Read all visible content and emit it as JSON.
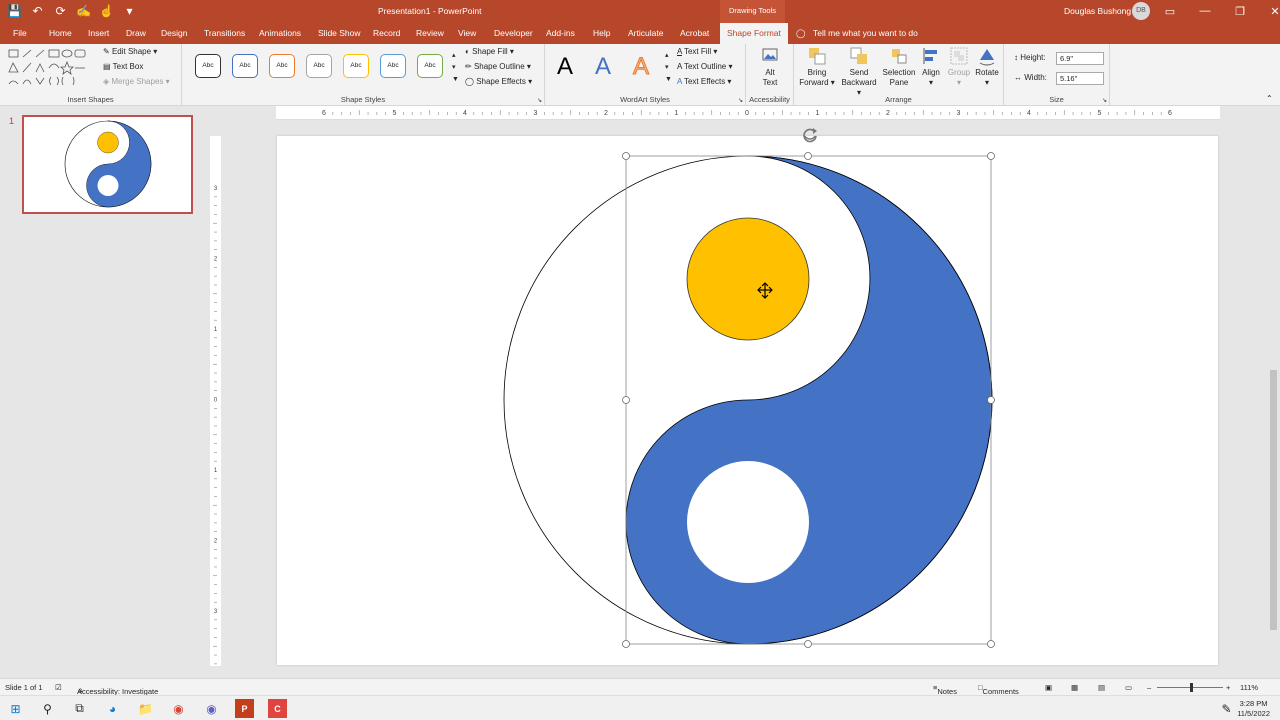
{
  "window": {
    "title": "Presentation1 - PowerPoint",
    "context_tab_group": "Drawing Tools",
    "user_name": "Douglas Bushong",
    "user_initials": "DB"
  },
  "qat": {
    "icons": [
      "save-icon",
      "undo-icon",
      "redo-icon",
      "format-painter-icon",
      "touch-mode-icon",
      "customize-qat-icon"
    ]
  },
  "tabs": [
    "File",
    "Home",
    "Insert",
    "Draw",
    "Design",
    "Transitions",
    "Animations",
    "Slide Show",
    "Record",
    "Review",
    "View",
    "Developer",
    "Add-ins",
    "Help",
    "Articulate",
    "Acrobat",
    "Shape Format"
  ],
  "tell_me": "Tell me what you want to do",
  "ribbon": {
    "insert_shapes": {
      "label": "Insert Shapes",
      "edit_shape": "Edit Shape",
      "text_box": "Text Box",
      "merge_shapes": "Merge Shapes"
    },
    "shape_styles": {
      "label": "Shape Styles",
      "preset_text": "Abc",
      "shape_fill": "Shape Fill",
      "shape_outline": "Shape Outline",
      "shape_effects": "Shape Effects"
    },
    "wordart": {
      "label": "WordArt Styles",
      "glyph": "A",
      "text_fill": "Text Fill",
      "text_outline": "Text Outline",
      "text_effects": "Text Effects"
    },
    "accessibility": {
      "label": "Accessibility",
      "alt_text_1": "Alt",
      "alt_text_2": "Text"
    },
    "arrange": {
      "label": "Arrange",
      "bring_forward_1": "Bring",
      "bring_forward_2": "Forward",
      "send_backward_1": "Send",
      "send_backward_2": "Backward",
      "selection_pane_1": "Selection",
      "selection_pane_2": "Pane",
      "align": "Align",
      "group": "Group",
      "rotate": "Rotate"
    },
    "size": {
      "label": "Size",
      "height_label": "Height:",
      "height_value": "6.9\"",
      "width_label": "Width:",
      "width_value": "5.16\""
    }
  },
  "ruler": {
    "h_labels": [
      "6",
      "5",
      "4",
      "3",
      "2",
      "1",
      "0",
      "1",
      "2",
      "3",
      "4",
      "5",
      "6"
    ],
    "v_labels": [
      "3",
      "2",
      "1",
      "0",
      "1",
      "2",
      "3"
    ]
  },
  "slide_panel": {
    "slide_number": "1"
  },
  "colors": {
    "accent": "#b7472a",
    "blue_shape": "#4472c4",
    "gold_circle": "#ffc000"
  },
  "status": {
    "slide": "Slide 1 of 1",
    "accessibility": "Accessibility: Investigate",
    "notes": "Notes",
    "comments": "Comments",
    "zoom": "111%"
  },
  "taskbar": {
    "time": "3:28 PM",
    "date": "11/5/2022"
  }
}
